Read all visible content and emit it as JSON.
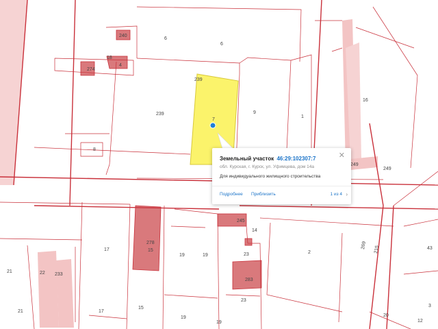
{
  "map": {
    "colors": {
      "boundary": "#c9303a",
      "thin_boundary": "#e3a2a6",
      "building_fill": "#d9797c",
      "pale_fill": "#f3c4c4",
      "highlight_fill": "#fbf36b",
      "highlight_stroke": "#d8c83b",
      "marker": "#1f7fd6"
    },
    "labels": {
      "l240": "240",
      "l18": "18",
      "l6a": "6",
      "l6b": "6",
      "l274": "274",
      "l4": "4",
      "l239": "239",
      "l239b": "239",
      "l7": "7",
      "l9": "9",
      "l1": "1",
      "l16": "16",
      "l8": "8",
      "l249": "249",
      "l249b": "249",
      "l245": "245",
      "l14": "14",
      "l278": "278",
      "l15a": "15",
      "l17a": "17",
      "l19a": "19",
      "l19b": "19",
      "l23a": "23",
      "l2": "2",
      "l269": "269",
      "l215": "215",
      "l43": "43",
      "l21a": "21",
      "l22": "22",
      "l233": "233",
      "l283": "283",
      "l23b": "23",
      "l21b": "21",
      "l15b": "15",
      "l17b": "17",
      "l19c": "19",
      "l19d": "19",
      "l20": "20",
      "l12": "12",
      "l3": "3"
    }
  },
  "popup": {
    "title": "Земельный участок",
    "cadastral_number": "46:29:102307:7",
    "address": "обл. Курская, г. Курск, ул. Уфимцева, дом 14а",
    "purpose": "Для индивидуального жилищного строительства",
    "more_label": "Подробнее",
    "zoom_label": "Приблизить",
    "pager": "1 из 4",
    "close_glyph": "✕",
    "next_glyph": "›"
  }
}
